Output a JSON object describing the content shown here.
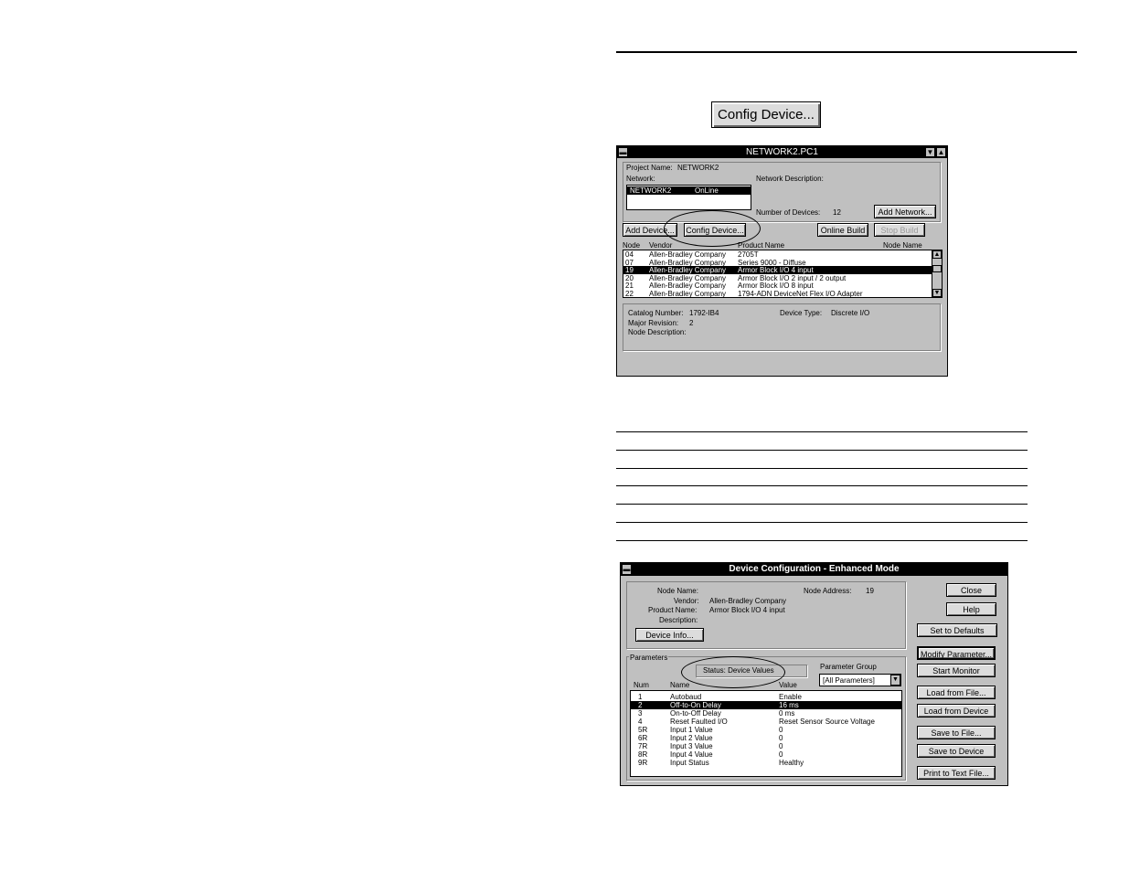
{
  "config_button_large": {
    "label": "Config Device..."
  },
  "network_window": {
    "title": "NETWORK2.PC1",
    "project_name_label": "Project Name:",
    "project_name": "NETWORK2",
    "network_label": "Network:",
    "network_list": [
      {
        "name": "NETWORK2",
        "status": "OnLine"
      }
    ],
    "network_description_label": "Network Description:",
    "number_of_devices_label": "Number of Devices:",
    "number_of_devices": "12",
    "add_network": "Add Network...",
    "add_device": "Add Device...",
    "config_device": "Config Device...",
    "online_build": "Online Build",
    "stop_build": "Stop Build",
    "columns": {
      "node": "Node",
      "vendor": "Vendor",
      "product": "Product Name",
      "node_name": "Node Name"
    },
    "devices": [
      {
        "node": "04",
        "vendor": "Allen-Bradley Company",
        "product": "2705T"
      },
      {
        "node": "07",
        "vendor": "Allen-Bradley Company",
        "product": "Series 9000 - Diffuse"
      },
      {
        "node": "19",
        "vendor": "Allen-Bradley Company",
        "product": "Armor Block I/O  4 input",
        "selected": true
      },
      {
        "node": "20",
        "vendor": "Allen-Bradley Company",
        "product": "Armor Block I/O  2 input / 2 output"
      },
      {
        "node": "21",
        "vendor": "Allen-Bradley Company",
        "product": "Armor Block I/O  8 input"
      },
      {
        "node": "22",
        "vendor": "Allen-Bradley Company",
        "product": "1794-ADN DeviceNet Flex I/O Adapter"
      }
    ],
    "catalog_number_label": "Catalog Number:",
    "catalog_number": "1792-IB4",
    "device_type_label": "Device Type:",
    "device_type": "Discrete I/O",
    "major_revision_label": "Major Revision:",
    "major_revision": "2",
    "node_description_label": "Node Description:"
  },
  "config_window": {
    "title": "Device Configuration - Enhanced Mode",
    "node_name_label": "Node Name:",
    "node_address_label": "Node Address:",
    "node_address": "19",
    "vendor_label": "Vendor:",
    "vendor": "Allen-Bradley Company",
    "product_name_label": "Product Name:",
    "product_name": "Armor Block I/O  4 input",
    "description_label": "Description:",
    "device_info": "Device Info...",
    "parameters_label": "Parameters",
    "status_text": "Status: Device Values",
    "parameter_group_label": "Parameter Group",
    "parameter_group_value": "[All Parameters]",
    "columns": {
      "num": "Num",
      "name": "Name",
      "value": "Value"
    },
    "parameters": [
      {
        "num": "1",
        "name": "Autobaud",
        "value": "Enable"
      },
      {
        "num": "2",
        "name": "Off-to-On Delay",
        "value": "16 ms",
        "selected": true
      },
      {
        "num": "3",
        "name": "On-to-Off Delay",
        "value": "0 ms"
      },
      {
        "num": "4",
        "name": "Reset Faulted I/O",
        "value": "Reset Sensor Source Voltage"
      },
      {
        "num": "5R",
        "name": "Input 1 Value",
        "value": "0"
      },
      {
        "num": "6R",
        "name": "Input 2 Value",
        "value": "0"
      },
      {
        "num": "7R",
        "name": "Input 3 Value",
        "value": "0"
      },
      {
        "num": "8R",
        "name": "Input 4 Value",
        "value": "0"
      },
      {
        "num": "9R",
        "name": "Input Status",
        "value": "Healthy"
      }
    ],
    "buttons": {
      "close": "Close",
      "help": "Help",
      "set_defaults": "Set to Defaults",
      "modify_parameter": "Modify Parameter...",
      "start_monitor": "Start Monitor",
      "load_from_file": "Load from File...",
      "load_from_device": "Load from Device",
      "save_to_file": "Save to File...",
      "save_to_device": "Save to Device",
      "print_to_text": "Print to Text File..."
    }
  }
}
